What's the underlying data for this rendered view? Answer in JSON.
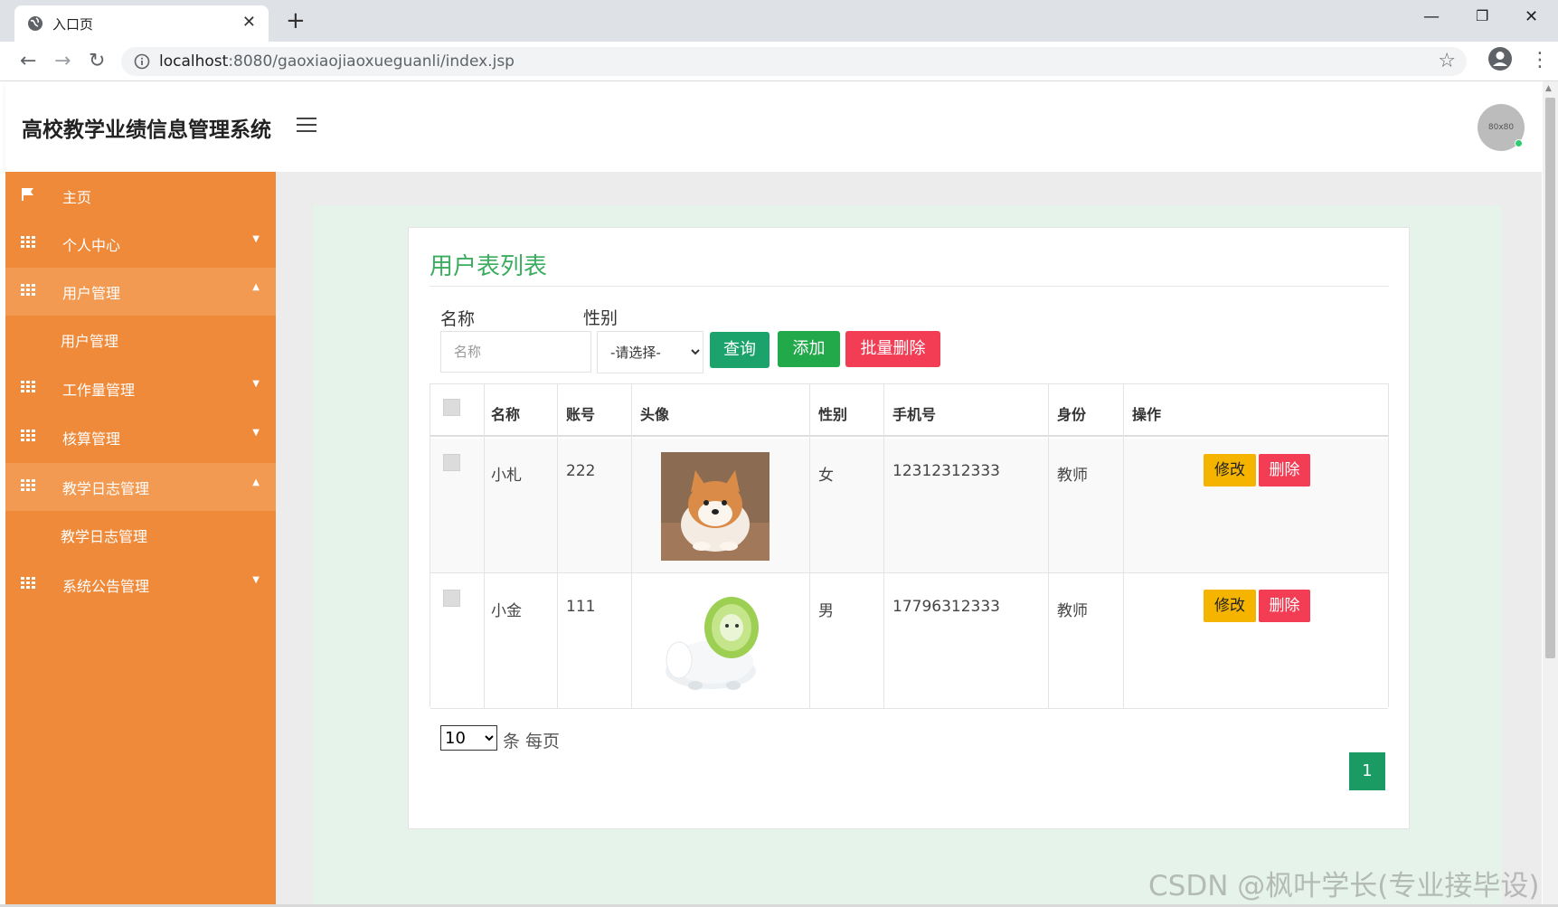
{
  "browser": {
    "tab_title": "入口页",
    "url_host": "localhost",
    "url_rest": ":8080/gaoxiaojiaoxueguanli/index.jsp"
  },
  "header": {
    "app_title": "高校教学业绩信息管理系统",
    "avatar_text": "80x80"
  },
  "sidebar": {
    "items": [
      {
        "label": "主页"
      },
      {
        "label": "个人中心"
      },
      {
        "label": "用户管理"
      },
      {
        "label": "用户管理"
      },
      {
        "label": "工作量管理"
      },
      {
        "label": "核算管理"
      },
      {
        "label": "教学日志管理"
      },
      {
        "label": "教学日志管理"
      },
      {
        "label": "系统公告管理"
      }
    ]
  },
  "main": {
    "title": "用户表列表",
    "search": {
      "name_label": "名称",
      "name_placeholder": "名称",
      "gender_label": "性别",
      "gender_selected": "-请选择-",
      "query_label": "查询",
      "add_label": "添加",
      "bulk_delete_label": "批量删除"
    },
    "table": {
      "headers": [
        "名称",
        "账号",
        "头像",
        "性别",
        "手机号",
        "身份",
        "操作"
      ],
      "rows": [
        {
          "name": "小札",
          "account": "222",
          "gender": "女",
          "phone": "12312312333",
          "role": "教师",
          "edit": "修改",
          "delete": "删除"
        },
        {
          "name": "小金",
          "account": "111",
          "gender": "男",
          "phone": "17796312333",
          "role": "教师",
          "edit": "修改",
          "delete": "删除"
        }
      ]
    },
    "pagination": {
      "per_page": "10",
      "per_page_label": "条 每页",
      "current_page": "1"
    }
  },
  "watermark": "CSDN @枫叶学长(专业接毕设)",
  "colors": {
    "sidebar": "#ee8a3a",
    "sidebar_active": "#f29a52",
    "title_green": "#3aad5f",
    "query": "#1ba36b",
    "add": "#22a94a",
    "danger": "#f23d54",
    "warning": "#f4b400"
  },
  "icons": {
    "home": "flag-icon",
    "menu": "grid-icon",
    "expand": "caret-icon"
  }
}
